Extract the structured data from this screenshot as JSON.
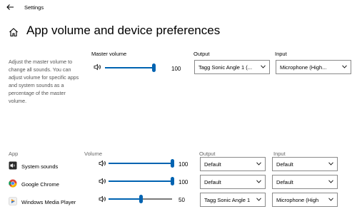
{
  "window": {
    "title": "Settings"
  },
  "page": {
    "title": "App volume and device preferences"
  },
  "description": "Adjust the master volume to change all sounds. You can adjust volume for specific apps and system sounds as a percentage of the master volume.",
  "master": {
    "label": "Master volume",
    "value": "100",
    "level_percent": 100,
    "output_label": "Output",
    "output_value": "Tagg Sonic Angle 1 (...",
    "input_label": "Input",
    "input_value": "Microphone (High..."
  },
  "apps_header": {
    "app": "App",
    "volume": "Volume",
    "output": "Output",
    "input": "Input"
  },
  "apps": [
    {
      "name": "System sounds",
      "icon": "system-sounds-icon",
      "value": "100",
      "level_percent": 100,
      "output": "Default",
      "input": "Default"
    },
    {
      "name": "Google Chrome",
      "icon": "chrome-icon",
      "value": "100",
      "level_percent": 100,
      "output": "Default",
      "input": "Default"
    },
    {
      "name": "Windows Media Player",
      "icon": "windows-media-player-icon",
      "value": "50",
      "level_percent": 50,
      "output": "Tagg Sonic Angle 1",
      "input": "Microphone (High"
    }
  ],
  "colors": {
    "accent": "#0063b1",
    "track": "#7a7a7a"
  }
}
